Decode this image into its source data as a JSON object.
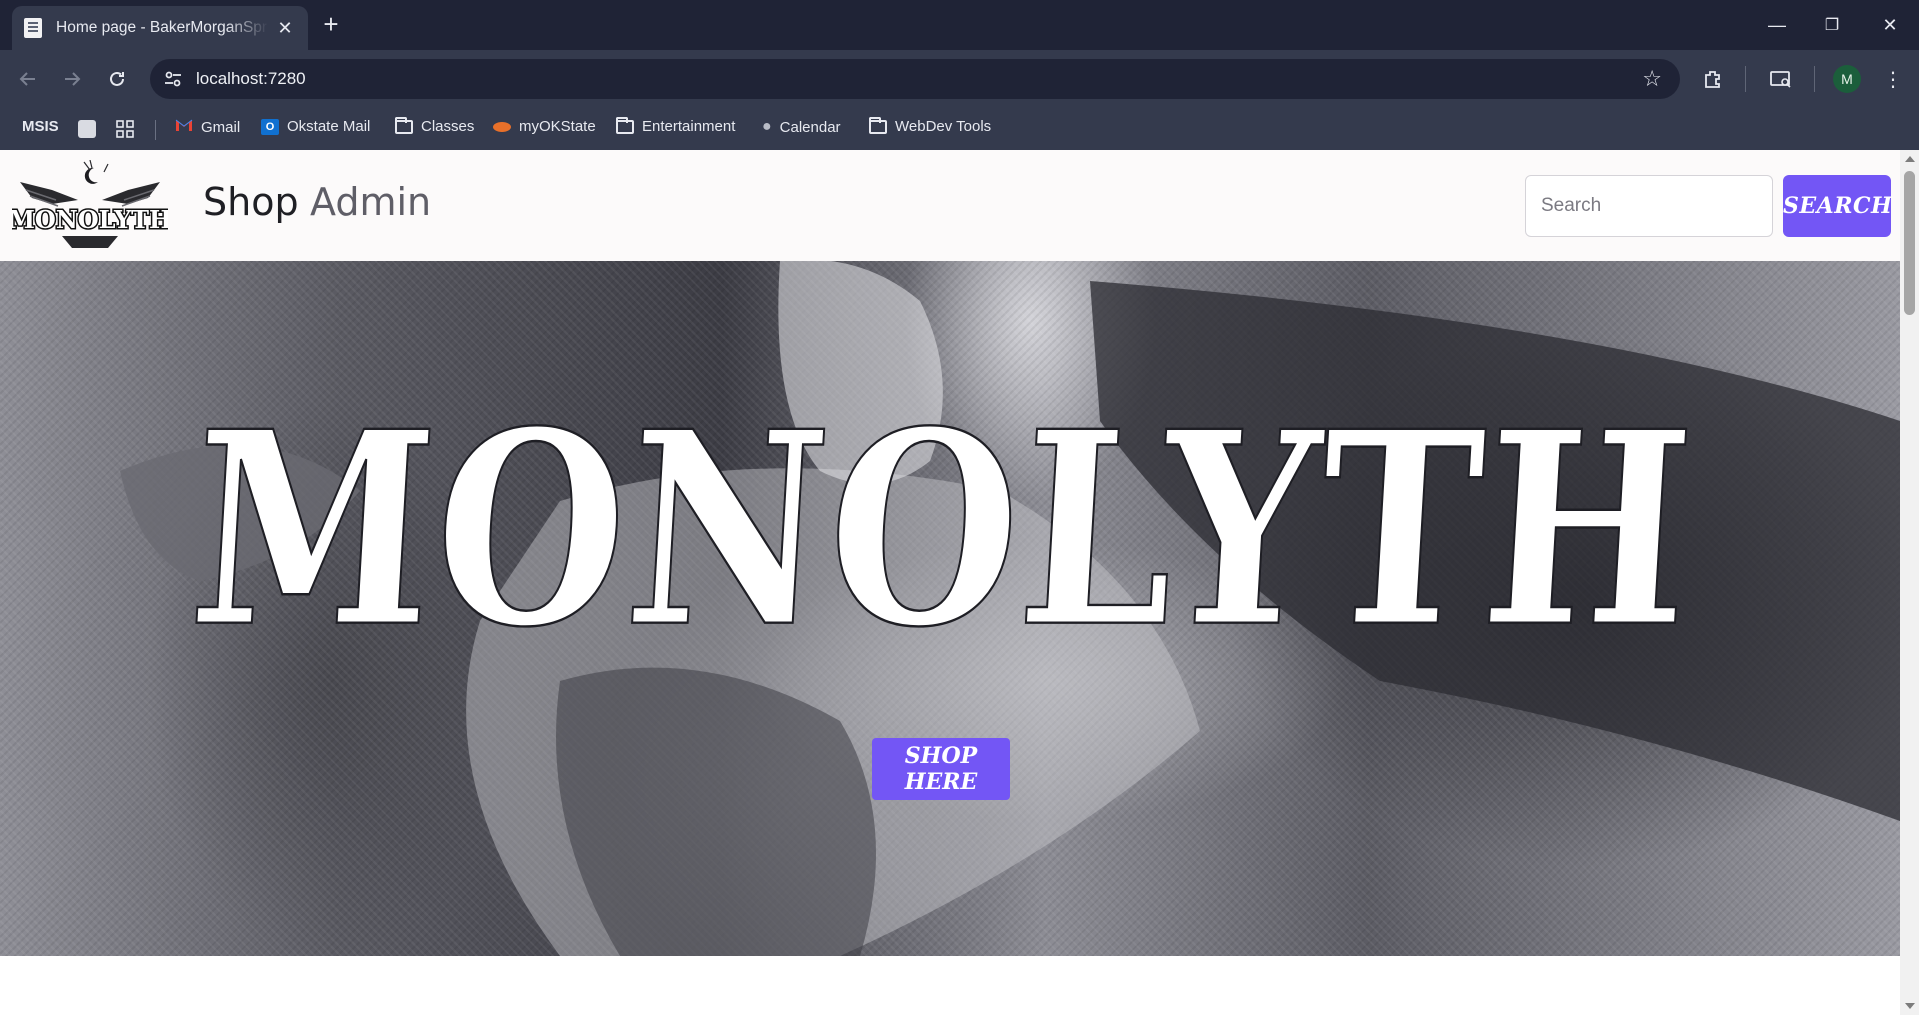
{
  "browser": {
    "tab_title": "Home page - BakerMorganSpring",
    "new_tab": "+",
    "tab_close": "✕",
    "url": "localhost:7280",
    "profile_initial": "M",
    "window_minimize": "—",
    "window_restore": "❐",
    "window_close": "✕"
  },
  "bookmarks": {
    "msis": "MSIS",
    "items": [
      "Gmail",
      "Okstate Mail",
      "Classes",
      "myOKState",
      "Entertainment",
      "Calendar",
      "WebDev Tools"
    ]
  },
  "site": {
    "logo_text": "MONOLYTH",
    "nav": {
      "shop": "Shop",
      "admin": "Admin"
    },
    "search": {
      "placeholder": "Search",
      "button": "SEARCH"
    },
    "hero": {
      "title": "MONOLYTH",
      "cta": "SHOP HERE"
    }
  },
  "colors": {
    "accent": "#7356f5",
    "browser_dark": "#1f2336",
    "browser_toolbar": "#343a4d",
    "page_bg": "#fcfafa"
  }
}
